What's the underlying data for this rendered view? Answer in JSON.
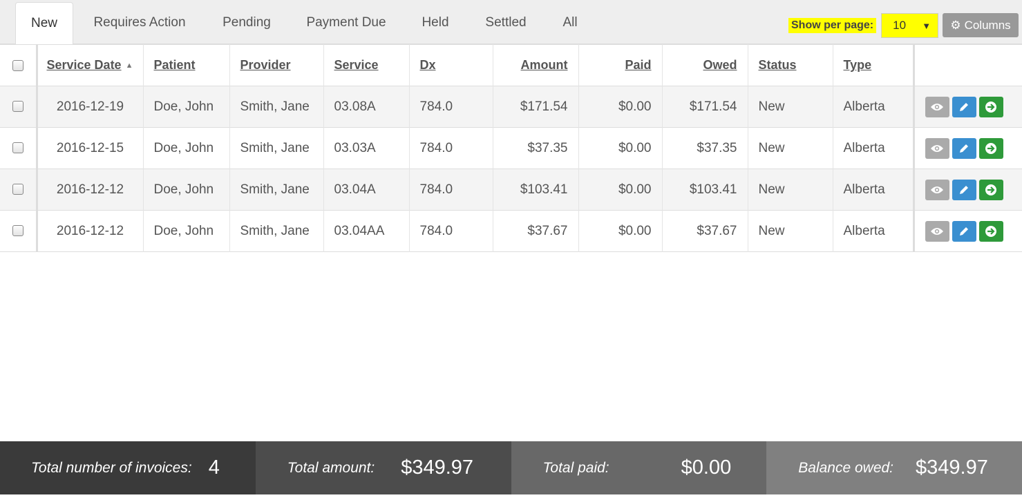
{
  "tabs": [
    {
      "label": "New",
      "active": true
    },
    {
      "label": "Requires Action",
      "active": false
    },
    {
      "label": "Pending",
      "active": false
    },
    {
      "label": "Payment Due",
      "active": false
    },
    {
      "label": "Held",
      "active": false
    },
    {
      "label": "Settled",
      "active": false
    },
    {
      "label": "All",
      "active": false
    }
  ],
  "per_page": {
    "label": "Show per page:",
    "value": "10",
    "highlight_color": "#ffff00"
  },
  "columns_button": {
    "label": "Columns",
    "icon": "gear-icon"
  },
  "table": {
    "headers": {
      "service_date": "Service Date",
      "patient": "Patient",
      "provider": "Provider",
      "service": "Service",
      "dx": "Dx",
      "amount": "Amount",
      "paid": "Paid",
      "owed": "Owed",
      "status": "Status",
      "type": "Type"
    },
    "sort_indicator": "▲",
    "rows": [
      {
        "service_date": "2016-12-19",
        "patient": "Doe, John",
        "provider": "Smith, Jane",
        "service": "03.08A",
        "dx": "784.0",
        "amount": "$171.54",
        "paid": "$0.00",
        "owed": "$171.54",
        "status": "New",
        "type": "Alberta"
      },
      {
        "service_date": "2016-12-15",
        "patient": "Doe, John",
        "provider": "Smith, Jane",
        "service": "03.03A",
        "dx": "784.0",
        "amount": "$37.35",
        "paid": "$0.00",
        "owed": "$37.35",
        "status": "New",
        "type": "Alberta"
      },
      {
        "service_date": "2016-12-12",
        "patient": "Doe, John",
        "provider": "Smith, Jane",
        "service": "03.04A",
        "dx": "784.0",
        "amount": "$103.41",
        "paid": "$0.00",
        "owed": "$103.41",
        "status": "New",
        "type": "Alberta"
      },
      {
        "service_date": "2016-12-12",
        "patient": "Doe, John",
        "provider": "Smith, Jane",
        "service": "03.04AA",
        "dx": "784.0",
        "amount": "$37.67",
        "paid": "$0.00",
        "owed": "$37.67",
        "status": "New",
        "type": "Alberta"
      }
    ],
    "row_actions": [
      {
        "name": "view",
        "icon": "eye-icon",
        "color": "#aaaaaa"
      },
      {
        "name": "edit",
        "icon": "pencil-icon",
        "color": "#3a8fd0"
      },
      {
        "name": "submit",
        "icon": "arrow-right-circle-icon",
        "color": "#2e9a3a"
      }
    ]
  },
  "footer": {
    "invoices_label": "Total number of invoices:",
    "invoices_value": "4",
    "amount_label": "Total amount:",
    "amount_value": "$349.97",
    "paid_label": "Total paid:",
    "paid_value": "$0.00",
    "owed_label": "Balance owed:",
    "owed_value": "$349.97"
  }
}
